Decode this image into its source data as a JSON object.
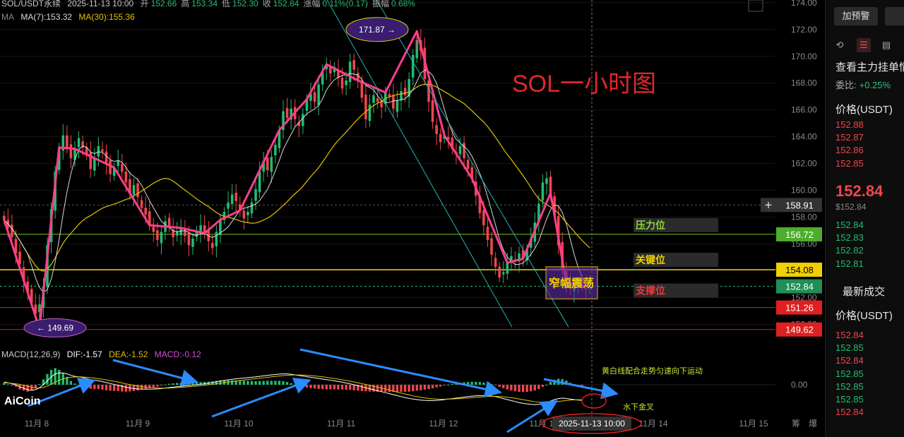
{
  "header": {
    "pair": "SOL/USDT永续",
    "datetime": "2025-11-13 10:00",
    "ohlc": [
      {
        "label": "开",
        "value": "152.66"
      },
      {
        "label": "高",
        "value": "153.34"
      },
      {
        "label": "低",
        "value": "152.30"
      },
      {
        "label": "收",
        "value": "152.84"
      },
      {
        "label": "涨幅",
        "value": "0.11%(0.17)"
      },
      {
        "label": "振幅",
        "value": "0.68%"
      }
    ],
    "ma_label": "MA",
    "ma7": "MA(7):153.32",
    "ma30": "MA(30):155.36"
  },
  "macd_header": {
    "name": "MACD(12,26,9)",
    "dif": "DIF:-1.57",
    "dea": "DEA:-1.52",
    "macd": "MACD:-0.12"
  },
  "annotations": {
    "title": "SOL一小时图",
    "resistance": "压力位",
    "key_level": "关键位",
    "support": "支撑位",
    "range": "窄幅震荡",
    "high_bubble": "171.87 →",
    "low_bubble": "← 149.69",
    "macd_note": "黄白线配合走势匀速向下运动",
    "golden_cross": "水下金叉"
  },
  "logo": "AiCoin",
  "crosshair_time": "2025-11-13 10:00",
  "colors": {
    "up": "#22bc72",
    "down": "#f0464d",
    "ma7": "#d9d9d9",
    "ma30": "#e0c400",
    "trend": "#ff3d8f",
    "channel": "#1fb5b5",
    "resistance_line": "#7cc52a",
    "key_line": "#e8d000",
    "support_line": "#e02020",
    "arrow": "#2a8cff",
    "bubble_fill": "#3a1d6e",
    "annotation_red": "#e02828",
    "resistance_text": "#8ad43a",
    "key_text": "#f0d000",
    "support_text": "#f03838"
  },
  "chart_data": {
    "type": "candlestick",
    "title": "SOL一小时图",
    "y_range": [
      148.5,
      174.2
    ],
    "y_ticks": [
      "174.00",
      "172.00",
      "170.00",
      "168.00",
      "166.00",
      "164.00",
      "162.00",
      "160.00",
      "158.00",
      "156.00",
      "154.00",
      "152.00",
      "150.00"
    ],
    "x_ticks": [
      "11月 8",
      "11月 9",
      "11月 10",
      "11月 11",
      "11月 12",
      "11月 13",
      "11月 14",
      "11月 15",
      "筹",
      "爆"
    ],
    "price_tags": [
      {
        "label": "158.91",
        "value": 158.91,
        "style": "dark"
      },
      {
        "label": "156.72",
        "value": 156.72,
        "style": "green"
      },
      {
        "label": "154.08",
        "value": 154.08,
        "style": "yellow"
      },
      {
        "label": "152.84",
        "value": 152.84,
        "style": "greenfill"
      },
      {
        "label": "151.26",
        "value": 151.26,
        "style": "red"
      },
      {
        "label": "149.62",
        "value": 149.62,
        "style": "red"
      }
    ],
    "levels": {
      "resistance": 156.72,
      "key": 154.08,
      "support_1": 151.26,
      "support_2": 149.62,
      "current": 152.84
    },
    "high": 171.87,
    "low": 149.69,
    "closes": [
      157.8,
      157.2,
      156.5,
      155.3,
      154.5,
      153.2,
      152.4,
      151.6,
      150.8,
      151.5,
      152.8,
      155.9,
      158.6,
      161.4,
      163.2,
      164.1,
      163.2,
      162.4,
      163.1,
      163.9,
      163.2,
      162.6,
      161.6,
      162.4,
      163.3,
      162.9,
      162.0,
      161.2,
      161.7,
      162.2,
      161.4,
      160.6,
      159.8,
      160.4,
      159.5,
      158.7,
      158.2,
      157.4,
      156.9,
      156.3,
      156.9,
      157.7,
      157.2,
      156.5,
      156.9,
      157.2,
      156.6,
      155.9,
      156.4,
      157.0,
      157.4,
      156.8,
      156.2,
      155.7,
      156.9,
      157.8,
      158.4,
      159.1,
      159.7,
      159.2,
      158.5,
      157.9,
      158.4,
      159.1,
      160.1,
      161.4,
      162.2,
      161.5,
      162.5,
      163.4,
      164.5,
      165.9,
      165.4,
      166.1,
      165.3,
      164.8,
      165.7,
      166.8,
      167.2,
      166.6,
      167.9,
      168.8,
      169.4,
      168.7,
      169.2,
      168.4,
      167.6,
      168.2,
      169.6,
      169.0,
      168.2,
      166.9,
      165.3,
      166.4,
      167.1,
      166.6,
      166.2,
      167.3,
      167.0,
      166.1,
      166.7,
      167.4,
      167.1,
      168.3,
      170.1,
      171.2,
      170.4,
      168.3,
      166.6,
      165.1,
      164.2,
      163.6,
      164.1,
      163.8,
      163.1,
      162.7,
      163.3,
      162.4,
      161.6,
      160.9,
      159.6,
      158.3,
      157.4,
      156.3,
      155.2,
      154.3,
      153.5,
      153.9,
      154.6,
      155.1,
      154.7,
      155.3,
      154.9,
      155.6,
      156.4,
      157.6,
      159.0,
      160.6,
      160.9,
      159.8,
      158.1,
      155.9,
      154.1,
      153.1,
      152.7,
      152.9,
      153.1,
      152.8,
      152.6,
      152.84
    ],
    "ma7_label": "MA(7)",
    "ma30_label": "MA(30)",
    "macd": {
      "zero_label": "0.00",
      "dif": [
        0.3,
        0.2,
        0.1,
        0.0,
        -0.2,
        -0.35,
        -0.5,
        -0.55,
        -0.5,
        -0.3,
        0.0,
        0.4,
        0.8,
        1.1,
        1.2,
        1.2,
        1.1,
        0.95,
        0.85,
        0.8,
        0.72,
        0.62,
        0.52,
        0.45,
        0.4,
        0.32,
        0.22,
        0.12,
        0.04,
        -0.05,
        -0.15,
        -0.25,
        -0.32,
        -0.38,
        -0.42,
        -0.44,
        -0.45,
        -0.45,
        -0.44,
        -0.42,
        -0.38,
        -0.33,
        -0.28,
        -0.24,
        -0.2,
        -0.16,
        -0.12,
        -0.08,
        -0.04,
        0.0,
        0.05,
        0.1,
        0.16,
        0.22,
        0.3,
        0.38,
        0.44,
        0.5,
        0.55,
        0.6,
        0.64,
        0.68,
        0.72,
        0.76,
        0.8,
        0.85,
        0.9,
        0.95,
        1.0,
        1.04,
        1.08,
        1.1,
        1.1,
        1.06,
        1.0,
        0.94,
        0.88,
        0.82,
        0.76,
        0.7,
        0.64,
        0.58,
        0.52,
        0.46,
        0.4,
        0.33,
        0.26,
        0.18,
        0.1,
        0.0,
        -0.1,
        -0.2,
        -0.3,
        -0.4,
        -0.5,
        -0.6,
        -0.7,
        -0.8,
        -0.9,
        -1.0,
        -1.1,
        -1.2,
        -1.3,
        -1.38,
        -1.45,
        -1.5,
        -1.55,
        -1.58,
        -1.6,
        -1.6,
        -1.58,
        -1.55,
        -1.5,
        -1.45,
        -1.4,
        -1.35,
        -1.3,
        -1.25,
        -1.2,
        -1.15,
        -1.12,
        -1.1,
        -1.1,
        -1.12,
        -1.15,
        -1.2,
        -1.3,
        -1.4,
        -1.5,
        -1.6,
        -1.7,
        -1.8,
        -1.88,
        -1.94,
        -1.98,
        -2.0,
        -1.98,
        -1.9,
        -1.8,
        -1.65,
        -1.5,
        -1.4,
        -1.35,
        -1.38,
        -1.45,
        -1.5,
        -1.55,
        -1.57
      ],
      "dea": [
        0.2,
        0.18,
        0.14,
        0.1,
        0.04,
        -0.05,
        -0.15,
        -0.25,
        -0.32,
        -0.33,
        -0.27,
        -0.14,
        0.05,
        0.26,
        0.45,
        0.6,
        0.7,
        0.76,
        0.79,
        0.8,
        0.79,
        0.76,
        0.72,
        0.67,
        0.62,
        0.56,
        0.5,
        0.42,
        0.35,
        0.27,
        0.19,
        0.1,
        0.02,
        -0.06,
        -0.13,
        -0.19,
        -0.24,
        -0.28,
        -0.31,
        -0.33,
        -0.34,
        -0.34,
        -0.33,
        -0.31,
        -0.29,
        -0.26,
        -0.23,
        -0.2,
        -0.17,
        -0.13,
        -0.09,
        -0.05,
        0.0,
        0.05,
        0.1,
        0.16,
        0.22,
        0.28,
        0.33,
        0.38,
        0.43,
        0.48,
        0.53,
        0.57,
        0.62,
        0.66,
        0.71,
        0.75,
        0.8,
        0.84,
        0.88,
        0.92,
        0.96,
        0.98,
        0.99,
        0.99,
        0.98,
        0.96,
        0.93,
        0.89,
        0.85,
        0.8,
        0.75,
        0.69,
        0.63,
        0.57,
        0.5,
        0.43,
        0.36,
        0.28,
        0.2,
        0.12,
        0.03,
        -0.06,
        -0.15,
        -0.24,
        -0.34,
        -0.44,
        -0.54,
        -0.64,
        -0.74,
        -0.84,
        -0.94,
        -1.03,
        -1.12,
        -1.2,
        -1.27,
        -1.33,
        -1.38,
        -1.42,
        -1.45,
        -1.46,
        -1.46,
        -1.45,
        -1.44,
        -1.42,
        -1.4,
        -1.37,
        -1.34,
        -1.3,
        -1.27,
        -1.24,
        -1.21,
        -1.19,
        -1.18,
        -1.18,
        -1.19,
        -1.22,
        -1.26,
        -1.31,
        -1.37,
        -1.44,
        -1.51,
        -1.58,
        -1.65,
        -1.71,
        -1.76,
        -1.79,
        -1.8,
        -1.79,
        -1.75,
        -1.7,
        -1.64,
        -1.59,
        -1.55,
        -1.53,
        -1.52,
        -1.52
      ]
    }
  },
  "sidebar": {
    "add_alert": "加预警",
    "icons": [
      "restore-icon",
      "orderbook-icon",
      "bid-book-icon",
      "ask-book-icon"
    ],
    "orderbook_title": "查看主力挂单情",
    "weibi_label": "委比:",
    "weibi_value": "+0.25%",
    "price_header": "价格(USDT)",
    "asks": [
      "152.88",
      "152.87",
      "152.86",
      "152.85"
    ],
    "last_price": "152.84",
    "last_price_usd": "$152.84",
    "bids": [
      "152.84",
      "152.83",
      "152.82",
      "152.81"
    ],
    "trades_title": "最新成交",
    "trades_price_header": "价格(USDT)",
    "trades": [
      {
        "price": "152.84",
        "side": "down"
      },
      {
        "price": "152.85",
        "side": "up"
      },
      {
        "price": "152.84",
        "side": "down"
      },
      {
        "price": "152.85",
        "side": "up"
      },
      {
        "price": "152.85",
        "side": "up"
      },
      {
        "price": "152.85",
        "side": "up"
      },
      {
        "price": "152.84",
        "side": "down"
      }
    ]
  }
}
